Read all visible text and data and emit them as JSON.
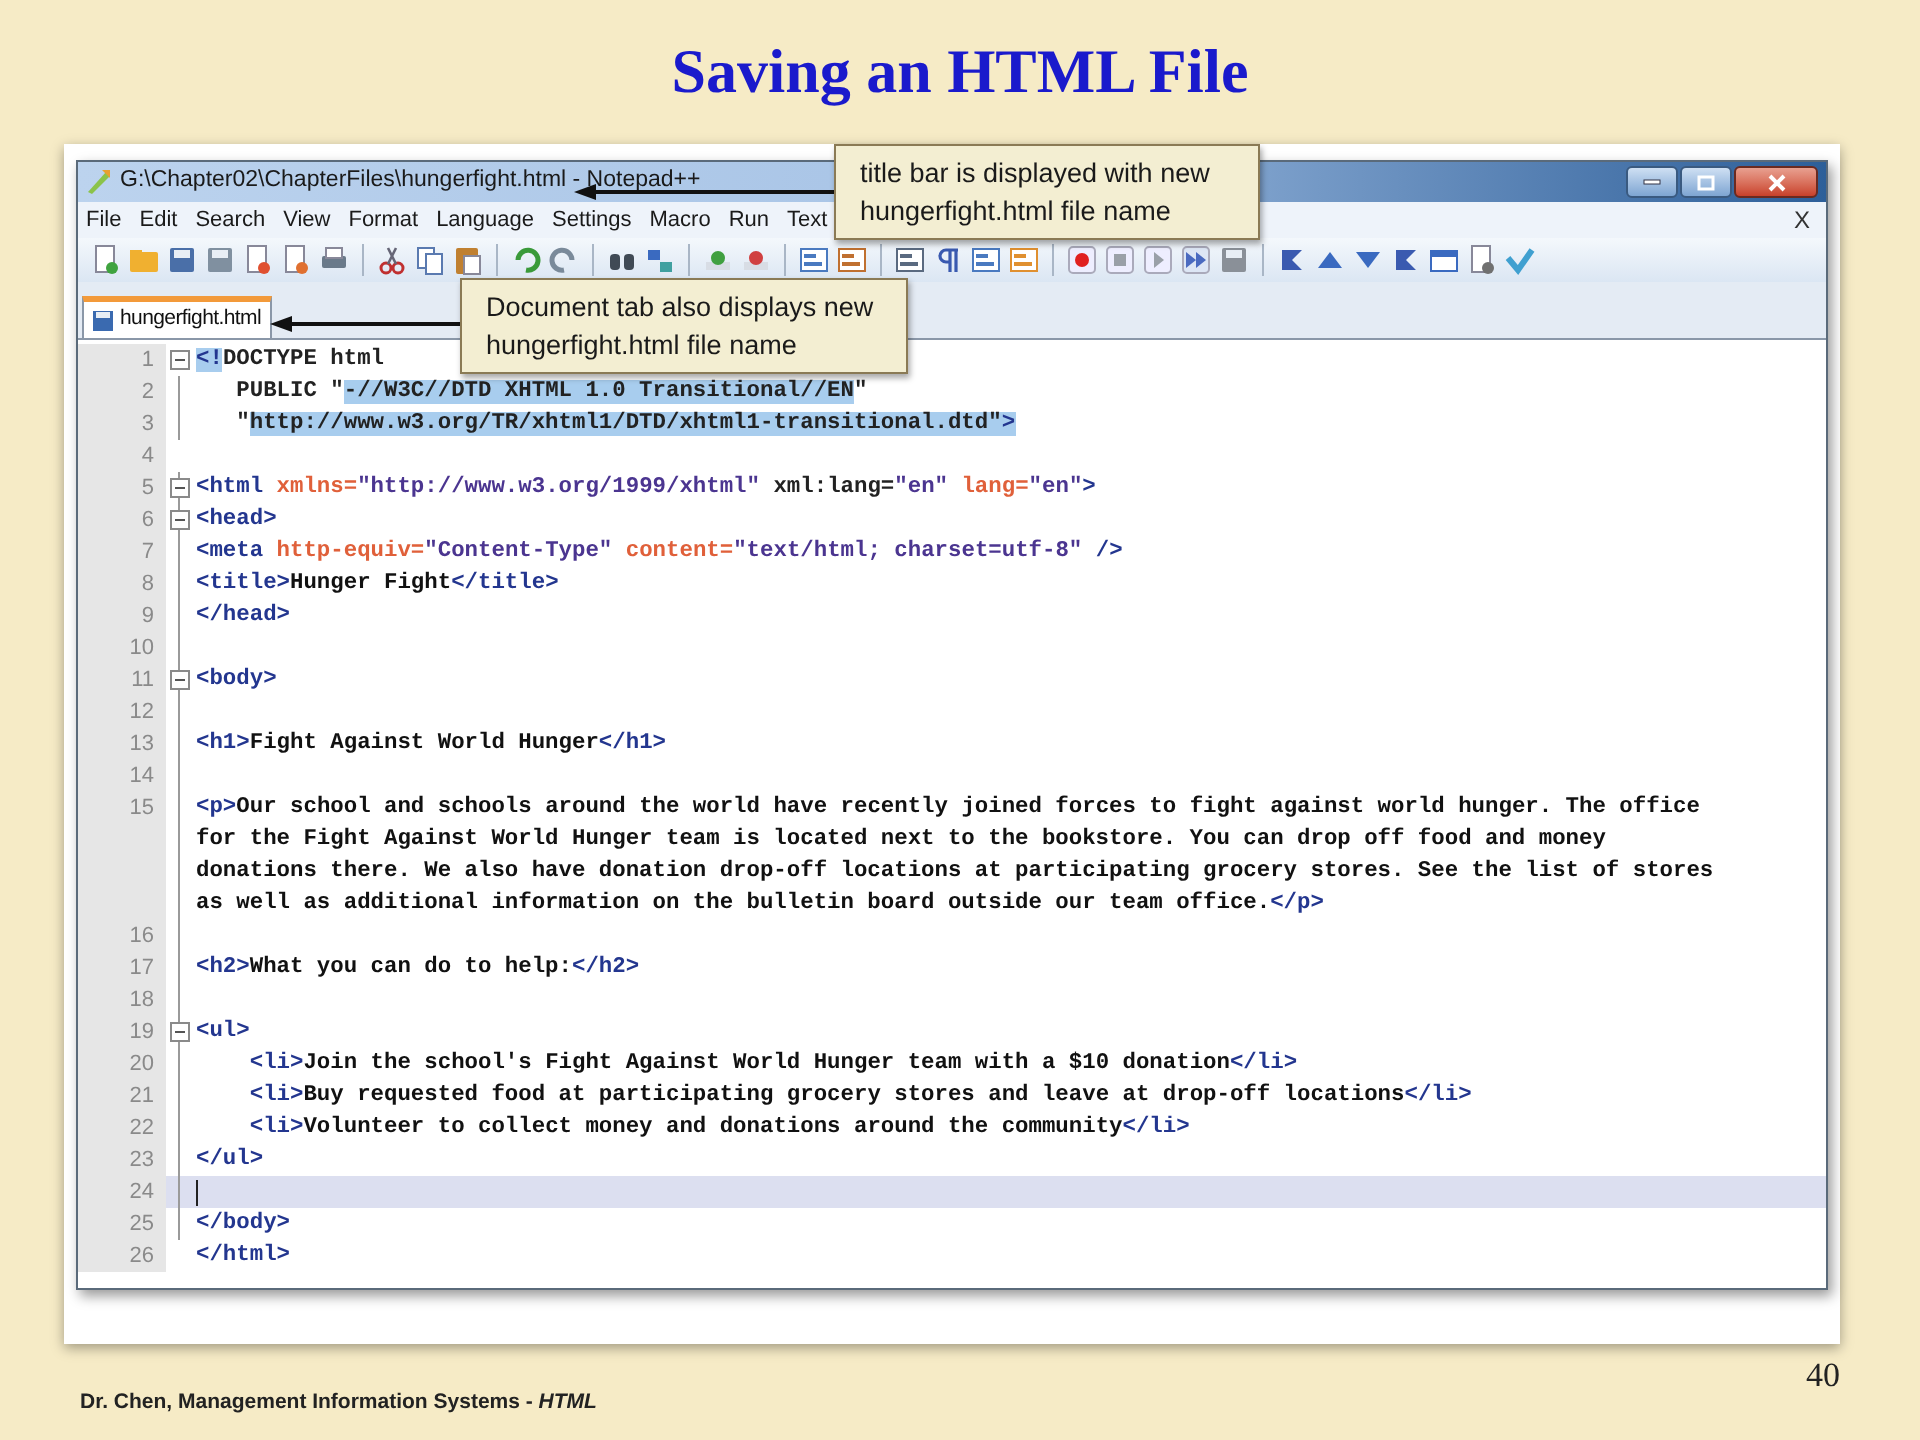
{
  "slide": {
    "title": "Saving an HTML File",
    "page_number": "40",
    "footer": {
      "author": "Dr. Chen, Management Information Systems - ",
      "topic": "HTML"
    }
  },
  "window": {
    "title": "G:\\Chapter02\\ChapterFiles\\hungerfight.html - Notepad++"
  },
  "menu": [
    "File",
    "Edit",
    "Search",
    "View",
    "Format",
    "Language",
    "Settings",
    "Macro",
    "Run",
    "Text"
  ],
  "menu_close": "X",
  "tabs": [
    {
      "label": "hungerfight.html",
      "selected": true
    }
  ],
  "editor": {
    "lines": [
      {
        "number": "1",
        "expanded": true,
        "current": false,
        "rows": [
          [
            {
              "kind": "tag",
              "text": "<!",
              "selected": true
            },
            {
              "kind": "plain",
              "text": "DOCTYPE html",
              "selected": false
            }
          ]
        ]
      },
      {
        "number": "2",
        "current": false,
        "rows": [
          [
            {
              "kind": "plain",
              "text": "   PUBLIC \"",
              "selected": false
            },
            {
              "kind": "plain",
              "text": "-//W3C//DTD XHTML 1.0 Transitional//EN",
              "selected": true
            },
            {
              "kind": "plain",
              "text": "\"",
              "selected": false
            }
          ]
        ]
      },
      {
        "number": "3",
        "current": false,
        "rows": [
          [
            {
              "kind": "plain",
              "text": "   \"",
              "selected": false
            },
            {
              "kind": "plain",
              "text": "http://www.w3.org/TR/xhtml1/DTD/xhtml1-transitional.dtd\"",
              "selected": true
            },
            {
              "kind": "tag",
              "text": ">",
              "selected": true
            }
          ]
        ]
      },
      {
        "number": "4",
        "current": false,
        "rows": [
          []
        ]
      },
      {
        "number": "5",
        "expanded": true,
        "current": false,
        "rows": [
          [
            {
              "kind": "tag",
              "text": "<html",
              "selected": false
            },
            {
              "kind": "attr",
              "text": " xmlns=",
              "selected": false
            },
            {
              "kind": "str",
              "text": "\"http://www.w3.org/1999/xhtml\"",
              "selected": false
            },
            {
              "kind": "plain",
              "text": " xml:lang=",
              "selected": false
            },
            {
              "kind": "str",
              "text": "\"en\"",
              "selected": false
            },
            {
              "kind": "attr",
              "text": " lang=",
              "selected": false
            },
            {
              "kind": "str",
              "text": "\"en\"",
              "selected": false
            },
            {
              "kind": "tag",
              "text": ">",
              "selected": false
            }
          ]
        ]
      },
      {
        "number": "6",
        "expanded": true,
        "current": false,
        "rows": [
          [
            {
              "kind": "tag",
              "text": "<head>",
              "selected": false
            }
          ]
        ]
      },
      {
        "number": "7",
        "current": false,
        "rows": [
          [
            {
              "kind": "tag",
              "text": "<meta",
              "selected": false
            },
            {
              "kind": "attr",
              "text": " http-equiv=",
              "selected": false
            },
            {
              "kind": "str",
              "text": "\"Content-Type\"",
              "selected": false
            },
            {
              "kind": "attr",
              "text": " content=",
              "selected": false
            },
            {
              "kind": "str",
              "text": "\"text/html; charset=utf-8\"",
              "selected": false
            },
            {
              "kind": "tag",
              "text": " />",
              "selected": false
            }
          ]
        ]
      },
      {
        "number": "8",
        "current": false,
        "rows": [
          [
            {
              "kind": "tag",
              "text": "<title>",
              "selected": false
            },
            {
              "kind": "text",
              "text": "Hunger Fight",
              "selected": false
            },
            {
              "kind": "tag",
              "text": "</title>",
              "selected": false
            }
          ]
        ]
      },
      {
        "number": "9",
        "current": false,
        "rows": [
          [
            {
              "kind": "tag",
              "text": "</head>",
              "selected": false
            }
          ]
        ]
      },
      {
        "number": "10",
        "current": false,
        "rows": [
          []
        ]
      },
      {
        "number": "11",
        "expanded": true,
        "current": false,
        "rows": [
          [
            {
              "kind": "tag",
              "text": "<body>",
              "selected": false
            }
          ]
        ]
      },
      {
        "number": "12",
        "current": false,
        "rows": [
          []
        ]
      },
      {
        "number": "13",
        "current": false,
        "rows": [
          [
            {
              "kind": "tag",
              "text": "<h1>",
              "selected": false
            },
            {
              "kind": "text",
              "text": "Fight Against World Hunger",
              "selected": false
            },
            {
              "kind": "tag",
              "text": "</h1>",
              "selected": false
            }
          ]
        ]
      },
      {
        "number": "14",
        "current": false,
        "rows": [
          []
        ]
      },
      {
        "number": "15",
        "current": false,
        "rows": [
          [
            {
              "kind": "tag",
              "text": "<p>",
              "selected": false
            },
            {
              "kind": "text",
              "text": "Our school and schools around the world have recently joined forces to fight against world hunger. The office",
              "selected": false
            }
          ],
          [
            {
              "kind": "text",
              "text": "for the Fight Against World Hunger team is located next to the bookstore. You can drop off food and money",
              "selected": false
            }
          ],
          [
            {
              "kind": "text",
              "text": "donations there. We also have donation drop-off locations at participating grocery stores. See the list of stores",
              "selected": false
            }
          ],
          [
            {
              "kind": "text",
              "text": "as well as additional information on the bulletin board outside our team office.",
              "selected": false
            },
            {
              "kind": "tag",
              "text": "</p>",
              "selected": false
            }
          ]
        ]
      },
      {
        "number": "16",
        "current": false,
        "rows": [
          []
        ]
      },
      {
        "number": "17",
        "current": false,
        "rows": [
          [
            {
              "kind": "tag",
              "text": "<h2>",
              "selected": false
            },
            {
              "kind": "text",
              "text": "What you can do to help:",
              "selected": false
            },
            {
              "kind": "tag",
              "text": "</h2>",
              "selected": false
            }
          ]
        ]
      },
      {
        "number": "18",
        "current": false,
        "rows": [
          []
        ]
      },
      {
        "number": "19",
        "expanded": true,
        "current": false,
        "rows": [
          [
            {
              "kind": "tag",
              "text": "<ul>",
              "selected": false
            }
          ]
        ]
      },
      {
        "number": "20",
        "current": false,
        "rows": [
          [
            {
              "kind": "tag",
              "text": "    <li>",
              "selected": false
            },
            {
              "kind": "text",
              "text": "Join the school's Fight Against World Hunger team with a $10 donation",
              "selected": false
            },
            {
              "kind": "tag",
              "text": "</li>",
              "selected": false
            }
          ]
        ]
      },
      {
        "number": "21",
        "current": false,
        "rows": [
          [
            {
              "kind": "tag",
              "text": "    <li>",
              "selected": false
            },
            {
              "kind": "text",
              "text": "Buy requested food at participating grocery stores and leave at drop-off locations",
              "selected": false
            },
            {
              "kind": "tag",
              "text": "</li>",
              "selected": false
            }
          ]
        ]
      },
      {
        "number": "22",
        "current": false,
        "rows": [
          [
            {
              "kind": "tag",
              "text": "    <li>",
              "selected": false
            },
            {
              "kind": "text",
              "text": "Volunteer to collect money and donations around the community",
              "selected": false
            },
            {
              "kind": "tag",
              "text": "</li>",
              "selected": false
            }
          ]
        ]
      },
      {
        "number": "23",
        "current": false,
        "rows": [
          [
            {
              "kind": "tag",
              "text": "</ul>",
              "selected": false
            }
          ]
        ]
      },
      {
        "number": "24",
        "current": true,
        "rows": [
          []
        ]
      },
      {
        "number": "25",
        "current": false,
        "rows": [
          [
            {
              "kind": "tag",
              "text": "</body>",
              "selected": false
            }
          ]
        ]
      },
      {
        "number": "26",
        "current": false,
        "rows": [
          [
            {
              "kind": "tag",
              "text": "</html>",
              "selected": false
            }
          ]
        ]
      }
    ]
  },
  "callouts": [
    {
      "text": "title bar is displayed with new\nhungerfight.html file name"
    },
    {
      "text": "Document tab also displays new\nhungerfight.html file name"
    }
  ]
}
